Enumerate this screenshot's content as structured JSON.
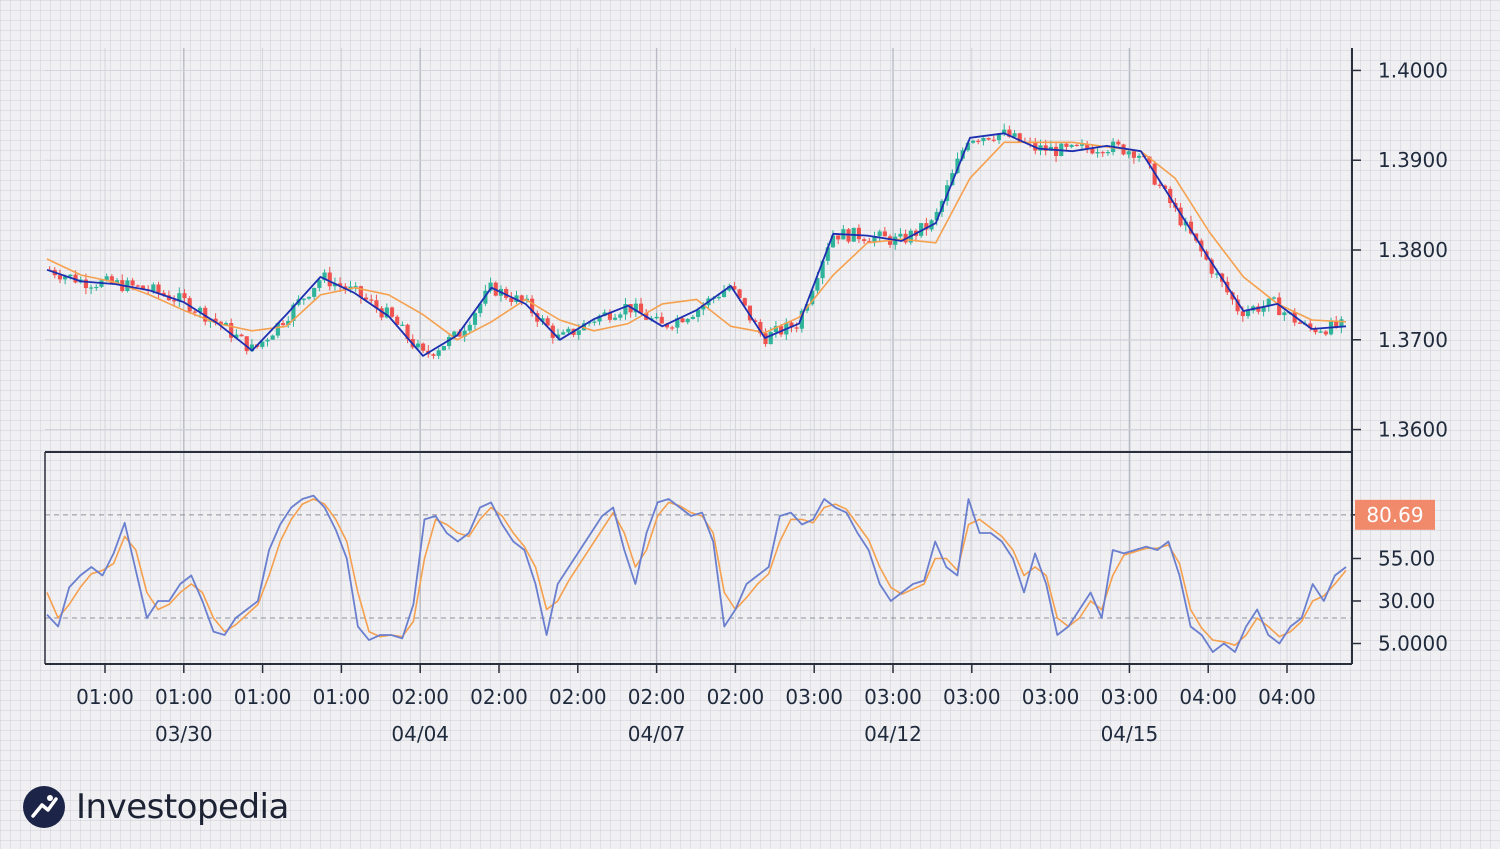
{
  "chart_data": [
    {
      "panel": "price",
      "type": "candlestick",
      "title": "",
      "xlabel": "",
      "ylabel": "",
      "ylim": [
        1.3575,
        1.4025
      ],
      "y_ticks": [
        "1.4000",
        "1.3900",
        "1.3800",
        "1.3700",
        "1.3600"
      ],
      "y_tick_values": [
        1.4,
        1.39,
        1.38,
        1.37,
        1.36
      ],
      "x_ticks": [
        "01:00",
        "01:00",
        "01:00",
        "01:00",
        "02:00",
        "02:00",
        "02:00",
        "02:00",
        "02:00",
        "03:00",
        "03:00",
        "03:00",
        "03:00",
        "03:00",
        "04:00",
        "04:00"
      ],
      "date_labels": [
        "03/30",
        "04/04",
        "04/07",
        "04/12",
        "04/15"
      ],
      "colors": {
        "up": "#2fb39a",
        "down": "#ef5350",
        "fast_ma": "#1e2fb0",
        "slow_ma": "#f5a04f"
      },
      "series": [
        {
          "role": "fast_ma",
          "values": [
            1.3778,
            1.3765,
            1.3762,
            1.3755,
            1.3742,
            1.3718,
            1.3688,
            1.3728,
            1.377,
            1.3752,
            1.3726,
            1.3682,
            1.3705,
            1.3758,
            1.374,
            1.37,
            1.3723,
            1.3738,
            1.3715,
            1.3733,
            1.376,
            1.3702,
            1.3718,
            1.3818,
            1.3816,
            1.381,
            1.383,
            1.3925,
            1.393,
            1.3913,
            1.391,
            1.3916,
            1.391,
            1.385,
            1.379,
            1.3732,
            1.374,
            1.3712,
            1.3715
          ]
        },
        {
          "role": "slow_ma",
          "values": [
            1.379,
            1.3772,
            1.3764,
            1.375,
            1.3733,
            1.3718,
            1.371,
            1.3715,
            1.375,
            1.3758,
            1.375,
            1.3728,
            1.37,
            1.372,
            1.3745,
            1.3722,
            1.371,
            1.3718,
            1.374,
            1.3745,
            1.3715,
            1.3708,
            1.3725,
            1.3772,
            1.3808,
            1.3812,
            1.3808,
            1.388,
            1.392,
            1.392,
            1.392,
            1.3915,
            1.391,
            1.388,
            1.382,
            1.377,
            1.374,
            1.3722,
            1.372
          ]
        }
      ]
    },
    {
      "panel": "oscillator",
      "type": "line",
      "ylim": [
        0,
        100
      ],
      "y_ticks": [
        "80.69",
        "55.00",
        "30.00",
        "5.0000"
      ],
      "y_tick_values": [
        80.69,
        55,
        30,
        5
      ],
      "reference_levels": [
        80.69,
        20
      ],
      "current_value_label": "80.69",
      "colors": {
        "k_line": "#6b7fcf",
        "d_line": "#f5a04f",
        "current_value_bg": "#f08a6b"
      },
      "series": [
        {
          "role": "k_line",
          "values": [
            22,
            15,
            38,
            45,
            50,
            45,
            58,
            76,
            48,
            20,
            30,
            30,
            40,
            45,
            30,
            12,
            10,
            20,
            25,
            30,
            60,
            75,
            85,
            90,
            92,
            85,
            72,
            55,
            15,
            7,
            10,
            10,
            8,
            28,
            78,
            80,
            70,
            65,
            70,
            85,
            88,
            75,
            65,
            60,
            40,
            10,
            40,
            50,
            60,
            70,
            80,
            85,
            60,
            40,
            70,
            88,
            90,
            85,
            80,
            82,
            65,
            15,
            25,
            40,
            45,
            50,
            80,
            82,
            75,
            78,
            90,
            85,
            82,
            70,
            60,
            40,
            30,
            35,
            40,
            42,
            65,
            50,
            45,
            90,
            70,
            70,
            65,
            55,
            35,
            58,
            40,
            10,
            15,
            25,
            35,
            20,
            60,
            58,
            60,
            62,
            60,
            65,
            45,
            15,
            10,
            0,
            5,
            0,
            15,
            25,
            10,
            5,
            15,
            20,
            40,
            30,
            45,
            50
          ]
        },
        {
          "role": "d_line",
          "values": [
            35,
            20,
            28,
            38,
            46,
            48,
            52,
            68,
            60,
            35,
            25,
            28,
            35,
            40,
            35,
            20,
            12,
            16,
            22,
            28,
            45,
            65,
            78,
            87,
            90,
            87,
            78,
            65,
            35,
            12,
            9,
            10,
            9,
            18,
            55,
            78,
            75,
            70,
            68,
            78,
            85,
            80,
            70,
            62,
            50,
            25,
            30,
            42,
            52,
            62,
            72,
            82,
            70,
            50,
            60,
            80,
            88,
            86,
            82,
            80,
            70,
            35,
            25,
            32,
            40,
            46,
            65,
            78,
            78,
            76,
            85,
            87,
            84,
            75,
            66,
            50,
            38,
            34,
            37,
            40,
            55,
            55,
            48,
            75,
            78,
            73,
            68,
            60,
            45,
            50,
            45,
            20,
            15,
            20,
            30,
            25,
            45,
            57,
            59,
            61,
            61,
            63,
            52,
            25,
            14,
            7,
            6,
            4,
            10,
            20,
            15,
            9,
            12,
            18,
            30,
            33,
            40,
            48
          ]
        }
      ]
    }
  ],
  "branding": {
    "logo_text": "Investopedia"
  }
}
